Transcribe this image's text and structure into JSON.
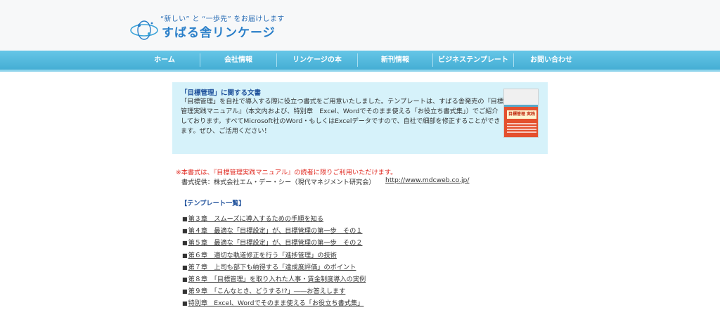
{
  "header": {
    "tagline": "“新しい” と “一歩先” をお届けします",
    "brand": "すばる舎リンケージ",
    "logo_icon": "subaru-star-logo-icon"
  },
  "nav": {
    "items": [
      {
        "label": "ホーム"
      },
      {
        "label": "会社情報"
      },
      {
        "label": "リンケージの本"
      },
      {
        "label": "新刊情報"
      },
      {
        "label": "ビジネステンプレート"
      },
      {
        "label": "お問い合わせ"
      }
    ]
  },
  "intro": {
    "title": "「目標管理」に関する文書",
    "body": "「目標管理」を自社で導入する際に役立つ書式をご用意いたしました。テンプレートは、すばる舎発売の『目標管理実践マニュアル』（本文内および、特別章　Excel、Wordでそのまま使える「お役立ち書式集」）でご紹介しております。すべてMicrosoft社のWord・もしくはExcelデータですので、自社で細部を修正することができます。ぜひ、ご活用ください！",
    "book_title": "目標管理 実践マニュアル"
  },
  "notice": "※本書式は、『目標管理実践マニュアル』の読者に限りご利用いただけます。",
  "provider": {
    "text": "書式提供：株式会社エム・デー・シー（現代マネジメント研究会）",
    "link": "http://www.mdcweb.co.jp/"
  },
  "templates": {
    "heading": "【テンプレート一覧】",
    "bullet": "■",
    "items": [
      {
        "label": "第３章　スムーズに導入するための手順を知る"
      },
      {
        "label": "第４章　最適な「目標設定」が、目標管理の第一歩　その１"
      },
      {
        "label": "第５章　最適な「目標設定」が、目標管理の第一歩　その２"
      },
      {
        "label": "第６章　適切な軌道修正を行う「進捗管理」の技術"
      },
      {
        "label": "第７章　上司も部下も納得する「達成度評価」のポイント"
      },
      {
        "label": "第８章　「目標管理」を取り入れた人事・賃金制度導入の実例"
      },
      {
        "label": "第９章　「こんなとき、どうする!?」――お答えします"
      },
      {
        "label": "特別章　Excel、Wordでそのまま使える「お役立ち書式集」"
      }
    ]
  },
  "colors": {
    "nav_bg": "#52b9de",
    "intro_bg": "#d6f2fa",
    "notice": "#e0281f",
    "heading": "#1d4f9a",
    "brand": "#2a7fc9"
  }
}
